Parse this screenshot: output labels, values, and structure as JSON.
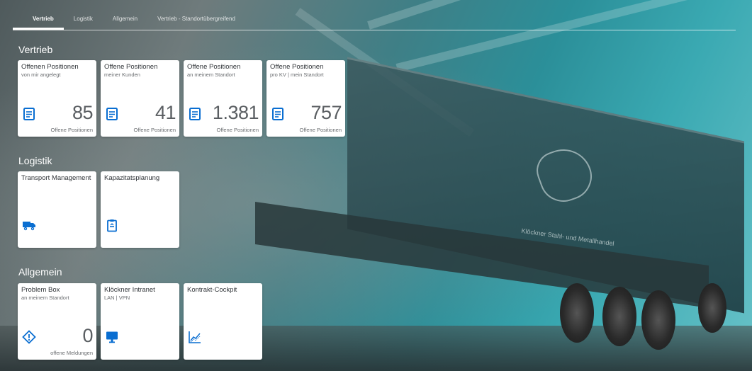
{
  "tabs": [
    {
      "label": "Vertrieb"
    },
    {
      "label": "Logistik"
    },
    {
      "label": "Allgemein"
    },
    {
      "label": "Vertrieb - Standortübergreifend"
    }
  ],
  "sections": {
    "vertrieb": {
      "title": "Vertrieb",
      "tiles": [
        {
          "title": "Offenen Positionen",
          "subtitle": "von mir angelegt",
          "icon": "document-list-icon",
          "value": "85",
          "unit": "Offene Positionen"
        },
        {
          "title": "Offene Positionen",
          "subtitle": "meiner Kunden",
          "icon": "document-list-icon",
          "value": "41",
          "unit": "Offene Positionen"
        },
        {
          "title": "Offene Positionen",
          "subtitle": "an meinem Standort",
          "icon": "document-list-icon",
          "value": "1.381",
          "unit": "Offene Positionen"
        },
        {
          "title": "Offene Positionen",
          "subtitle": "pro KV | mein Standort",
          "icon": "document-list-icon",
          "value": "757",
          "unit": "Offene Positionen"
        }
      ]
    },
    "logistik": {
      "title": "Logistik",
      "tiles": [
        {
          "title": "Transport Management",
          "icon": "truck-icon"
        },
        {
          "title": "Kapazitatsplanung",
          "icon": "clipboard-icon"
        }
      ]
    },
    "allgemein": {
      "title": "Allgemein",
      "tiles": [
        {
          "title": "Problem Box",
          "subtitle": "an meinem Standort",
          "icon": "warning-diamond-icon",
          "value": "0",
          "unit": "offene Meldungen"
        },
        {
          "title": "Klöckner Intranet",
          "subtitle": "LAN | VPN",
          "icon": "monitor-icon"
        },
        {
          "title": "Kontrakt-Cockpit",
          "icon": "line-chart-icon"
        }
      ]
    }
  },
  "colors": {
    "accent": "#0a6ed1",
    "tile_bg": "#ffffff",
    "number": "#5a5e62"
  }
}
